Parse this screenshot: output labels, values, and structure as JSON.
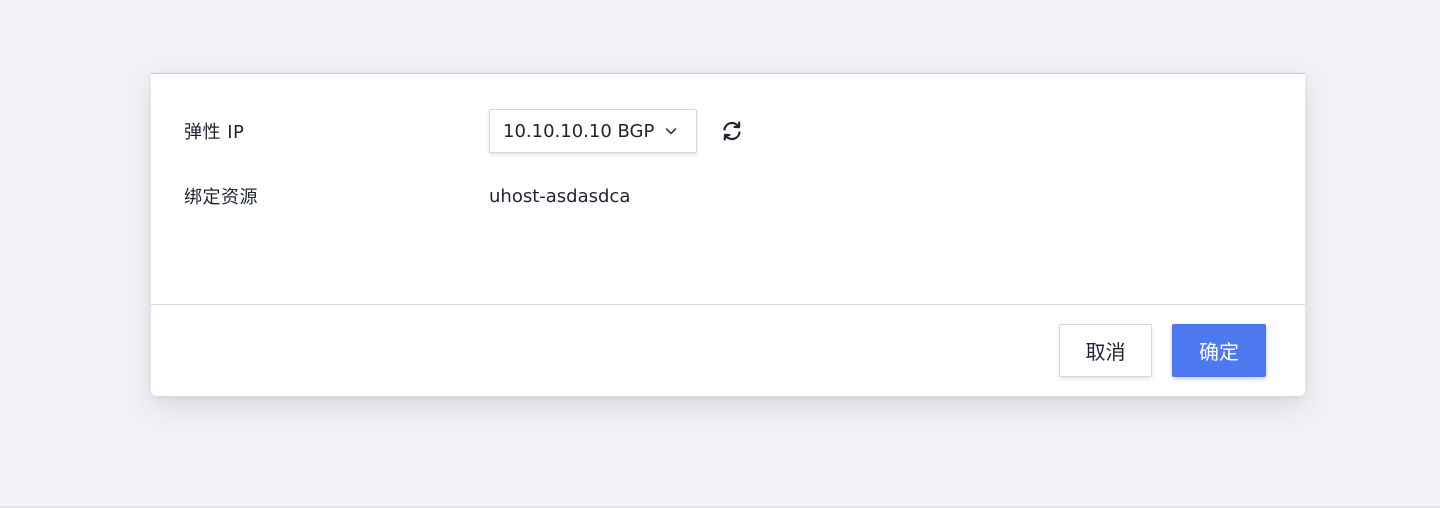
{
  "form": {
    "eip": {
      "label": "弹性 IP",
      "selected": "10.10.10.10 BGP",
      "dropdown_icon": "chevron-down-icon",
      "refresh_icon": "refresh-icon"
    },
    "resource": {
      "label": "绑定资源",
      "value": "uhost-asdasdca"
    }
  },
  "footer": {
    "cancel_label": "取消",
    "confirm_label": "确定"
  },
  "colors": {
    "background": "#f2f2f6",
    "primary": "#4d79f0",
    "text": "#1f2333"
  }
}
